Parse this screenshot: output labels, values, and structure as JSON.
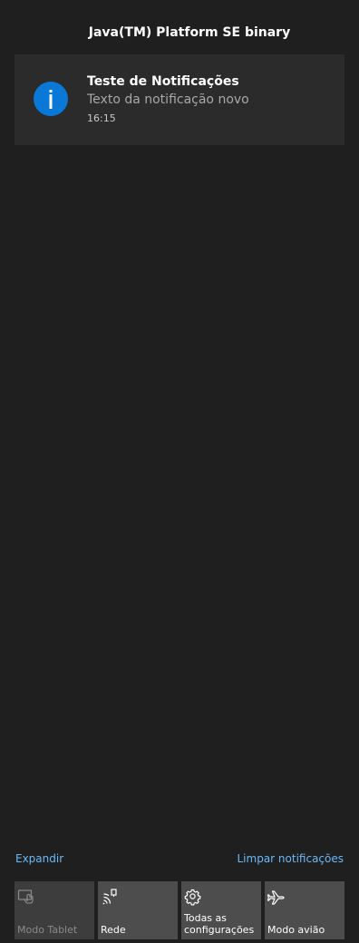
{
  "header": {
    "app_name": "Java(TM) Platform SE binary"
  },
  "notification": {
    "icon": "info-icon",
    "title": "Teste de Notificações",
    "body": "Texto da notificação novo",
    "time": "16:15",
    "icon_color": "#0a78d7"
  },
  "links": {
    "expand": "Expandir",
    "clear": "Limpar notificações",
    "color": "#6cb8f6"
  },
  "quick_actions": [
    {
      "label": "Modo Tablet",
      "icon": "tablet-mode-icon",
      "enabled": false
    },
    {
      "label": "Rede",
      "icon": "network-icon",
      "enabled": true
    },
    {
      "label": "Todas as configurações",
      "icon": "gear-icon",
      "enabled": true
    },
    {
      "label": "Modo avião",
      "icon": "airplane-icon",
      "enabled": true
    }
  ],
  "colors": {
    "background": "#1f1f1f",
    "card": "#2b2b2b",
    "tile": "#4d4d4d"
  }
}
